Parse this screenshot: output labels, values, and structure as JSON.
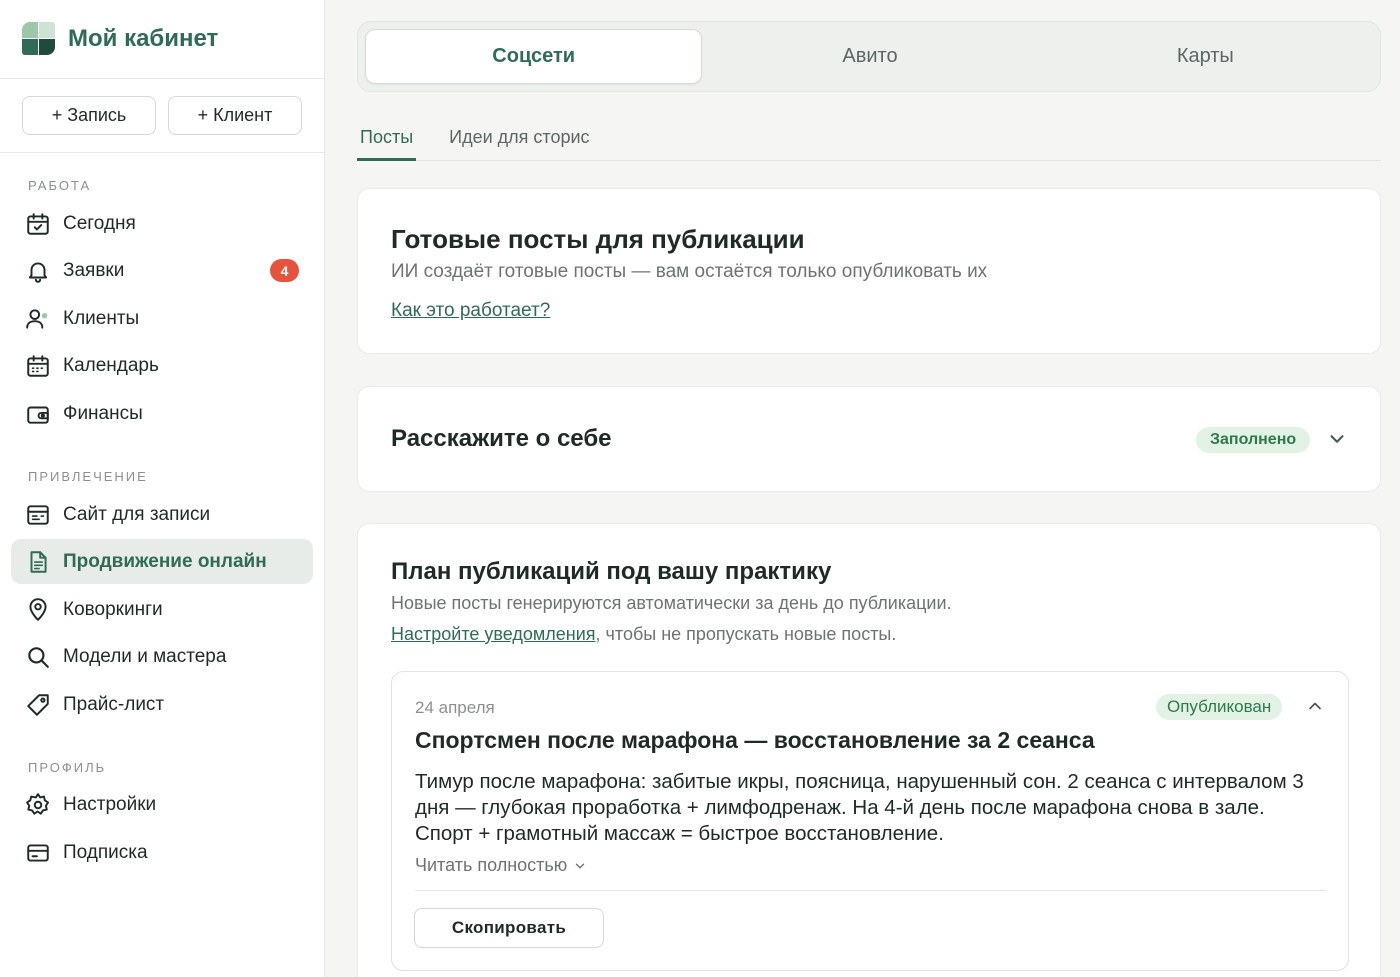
{
  "brand": {
    "title": "Мой кабинет"
  },
  "quick_actions": {
    "add_record": "+ Запись",
    "add_client": "+ Клиент"
  },
  "sidebar": {
    "sections": [
      {
        "label": "РАБОТА",
        "items": [
          {
            "label": "Сегодня",
            "icon": "calendar-check-icon"
          },
          {
            "label": "Заявки",
            "icon": "bell-icon",
            "badge": "4"
          },
          {
            "label": "Клиенты",
            "icon": "users-icon"
          },
          {
            "label": "Календарь",
            "icon": "calendar-icon"
          },
          {
            "label": "Финансы",
            "icon": "wallet-icon"
          }
        ]
      },
      {
        "label": "ПРИВЛЕЧЕНИЕ",
        "items": [
          {
            "label": "Сайт для записи",
            "icon": "browser-icon"
          },
          {
            "label": "Продвижение онлайн",
            "icon": "document-icon",
            "active": true
          },
          {
            "label": "Коворкинги",
            "icon": "map-pin-icon"
          },
          {
            "label": "Модели и мастера",
            "icon": "search-icon"
          },
          {
            "label": "Прайс-лист",
            "icon": "tag-icon"
          }
        ]
      },
      {
        "label": "ПРОФИЛЬ",
        "items": [
          {
            "label": "Настройки",
            "icon": "gear-icon"
          },
          {
            "label": "Подписка",
            "icon": "credit-card-icon"
          }
        ]
      }
    ]
  },
  "top_tabs": [
    {
      "label": "Соцсети",
      "active": true
    },
    {
      "label": "Авито"
    },
    {
      "label": "Карты"
    }
  ],
  "sub_tabs": [
    {
      "label": "Посты",
      "active": true
    },
    {
      "label": "Идеи для сторис"
    }
  ],
  "ready_posts": {
    "title": "Готовые посты для публикации",
    "subtitle": "ИИ создаёт готовые посты — вам остаётся только опубликовать их",
    "link": "Как это работает?"
  },
  "about": {
    "title": "Расскажите о себе",
    "status": "Заполнено"
  },
  "plan": {
    "title": "План публикаций под вашу практику",
    "subtitle": "Новые посты генерируются автоматически за день до публикации.",
    "notify_link": "Настройте уведомления",
    "notify_rest": ", чтобы не пропускать новые посты.",
    "post": {
      "date": "24 апреля",
      "status": "Опубликован",
      "title": "Спортсмен после марафона — восстановление за 2 сеанса",
      "body": "Тимур после марафона: забитые икры, поясница, нарушенный сон. 2 сеанса с интервалом 3 дня — глубокая проработка + лимфодренаж. На 4-й день после марафона снова в зале. Спорт + грамотный массаж = быстрое восстановление.",
      "read_more": "Читать полностью",
      "copy_label": "Скопировать"
    }
  },
  "colors": {
    "accent": "#2f6b55",
    "badge": "#e5533d",
    "status_bg": "#e2f3e6",
    "status_text": "#2f7a4a"
  }
}
